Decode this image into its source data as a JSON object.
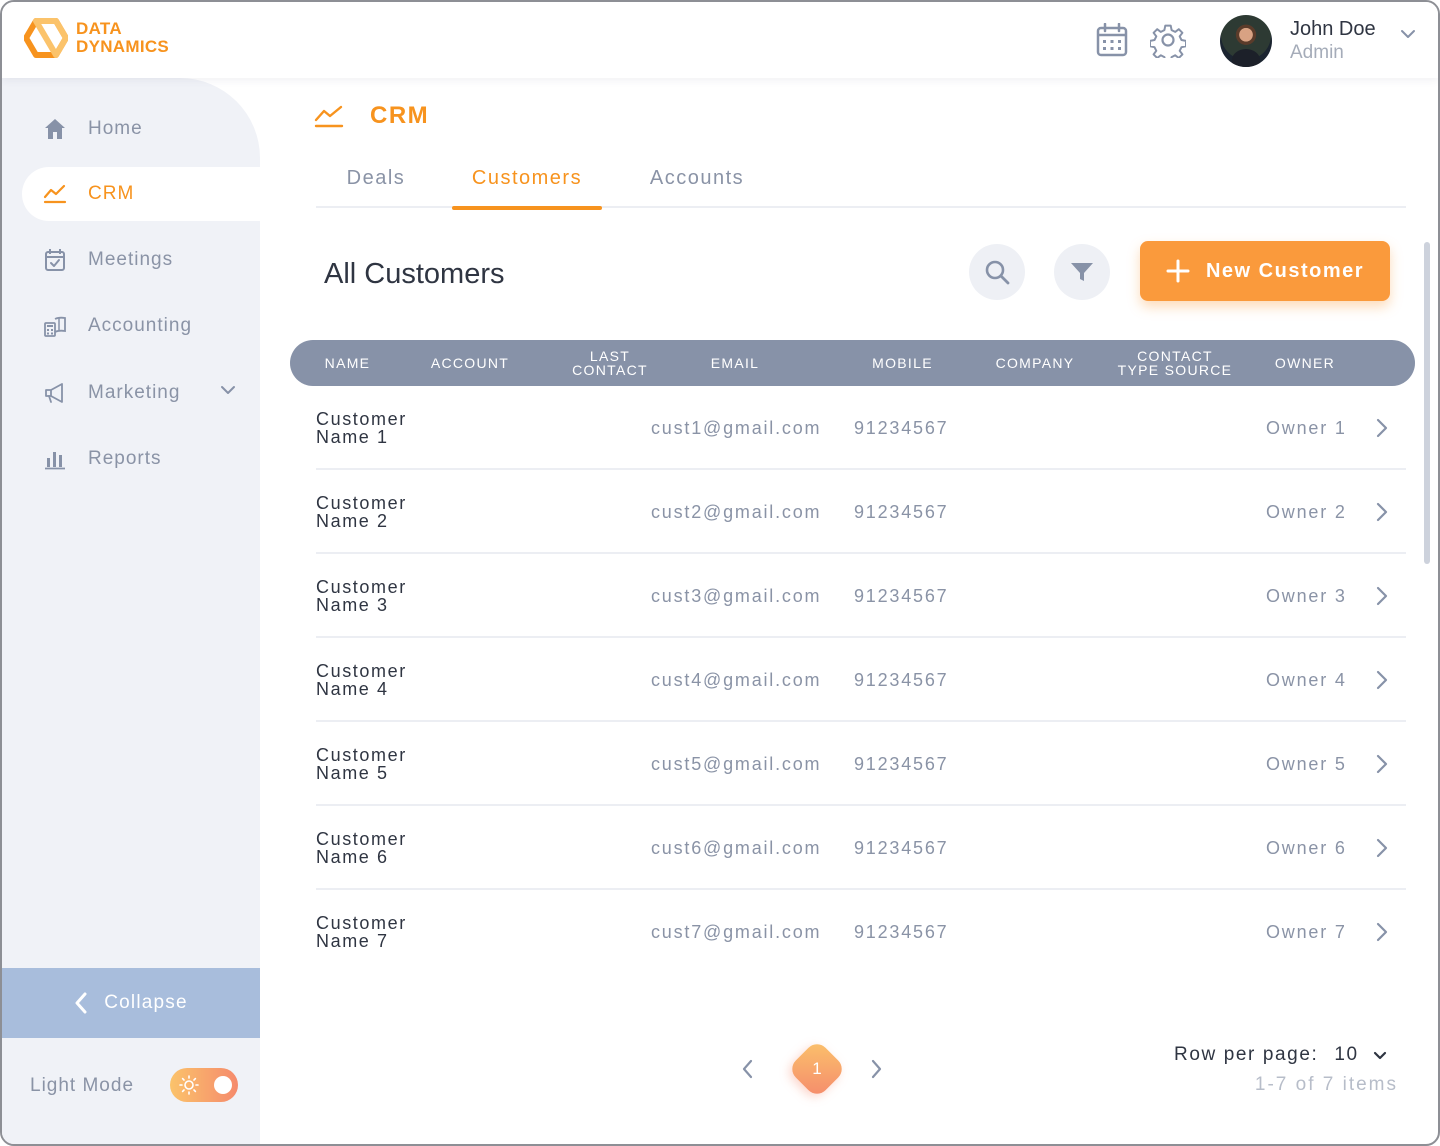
{
  "brand": {
    "line1": "DATA",
    "line2": "DYNAMICS",
    "color": "#f7931e"
  },
  "header": {
    "calendar_icon": "calendar-icon",
    "settings_icon": "gear-icon",
    "user": {
      "name": "John Doe",
      "role": "Admin"
    }
  },
  "sidebar": {
    "items": [
      {
        "label": "Home",
        "icon": "home-icon"
      },
      {
        "label": "CRM",
        "icon": "trend-line-icon",
        "active": true
      },
      {
        "label": "Meetings",
        "icon": "calendar-check-icon"
      },
      {
        "label": "Accounting",
        "icon": "calculator-book-icon"
      },
      {
        "label": "Marketing",
        "icon": "megaphone-icon",
        "expandable": true
      },
      {
        "label": "Reports",
        "icon": "bar-chart-icon"
      }
    ],
    "collapse_label": "Collapse",
    "mode_label": "Light Mode",
    "mode_on": true
  },
  "page": {
    "title": "CRM",
    "tabs": [
      {
        "label": "Deals"
      },
      {
        "label": "Customers",
        "active": true
      },
      {
        "label": "Accounts"
      }
    ],
    "section_title": "All Customers",
    "new_button_label": "New Customer"
  },
  "table": {
    "columns": [
      {
        "line1": "NAME",
        "line2": ""
      },
      {
        "line1": "ACCOUNT",
        "line2": ""
      },
      {
        "line1": "LAST",
        "line2": "CONTACT"
      },
      {
        "line1": "EMAIL",
        "line2": ""
      },
      {
        "line1": "MOBILE",
        "line2": ""
      },
      {
        "line1": "COMPANY",
        "line2": ""
      },
      {
        "line1": "CONTACT",
        "line2": "TYPE SOURCE"
      },
      {
        "line1": "OWNER",
        "line2": ""
      }
    ],
    "rows": [
      {
        "name1": "Customer",
        "name2": "Name 1",
        "email": "cust1@gmail.com",
        "mobile": "91234567",
        "owner": "Owner 1"
      },
      {
        "name1": "Customer",
        "name2": "Name 2",
        "email": "cust2@gmail.com",
        "mobile": "91234567",
        "owner": "Owner 2"
      },
      {
        "name1": "Customer",
        "name2": "Name 3",
        "email": "cust3@gmail.com",
        "mobile": "91234567",
        "owner": "Owner 3"
      },
      {
        "name1": "Customer",
        "name2": "Name 4",
        "email": "cust4@gmail.com",
        "mobile": "91234567",
        "owner": "Owner 4"
      },
      {
        "name1": "Customer",
        "name2": "Name 5",
        "email": "cust5@gmail.com",
        "mobile": "91234567",
        "owner": "Owner 5"
      },
      {
        "name1": "Customer",
        "name2": "Name 6",
        "email": "cust6@gmail.com",
        "mobile": "91234567",
        "owner": "Owner 6"
      },
      {
        "name1": "Customer",
        "name2": "Name 7",
        "email": "cust7@gmail.com",
        "mobile": "91234567",
        "owner": "Owner 7"
      }
    ]
  },
  "pagination": {
    "current_page": "1",
    "rows_per_page_label": "Row per page:",
    "rows_per_page": "10",
    "items_text": "1-7 of 7 items"
  }
}
